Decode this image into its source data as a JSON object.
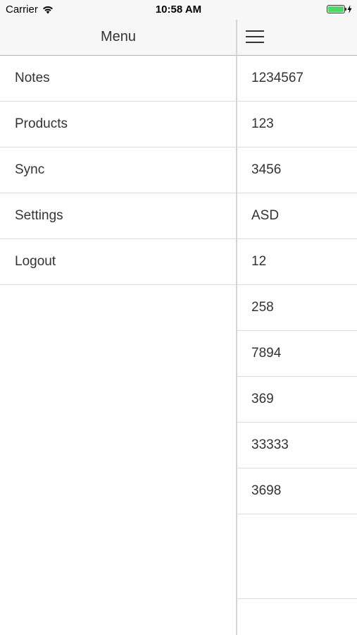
{
  "status_bar": {
    "carrier": "Carrier",
    "time": "10:58 AM",
    "battery_level": 1.0,
    "battery_color": "#4cd964"
  },
  "menu": {
    "title": "Menu",
    "items": [
      {
        "label": "Notes"
      },
      {
        "label": "Products"
      },
      {
        "label": "Sync"
      },
      {
        "label": "Settings"
      },
      {
        "label": "Logout"
      }
    ]
  },
  "content": {
    "menu_button_icon": "hamburger-icon",
    "items": [
      {
        "label": "1234567"
      },
      {
        "label": "123"
      },
      {
        "label": "3456"
      },
      {
        "label": "ASD"
      },
      {
        "label": "12"
      },
      {
        "label": "258"
      },
      {
        "label": "7894"
      },
      {
        "label": "369"
      },
      {
        "label": "33333"
      },
      {
        "label": "3698"
      }
    ]
  }
}
